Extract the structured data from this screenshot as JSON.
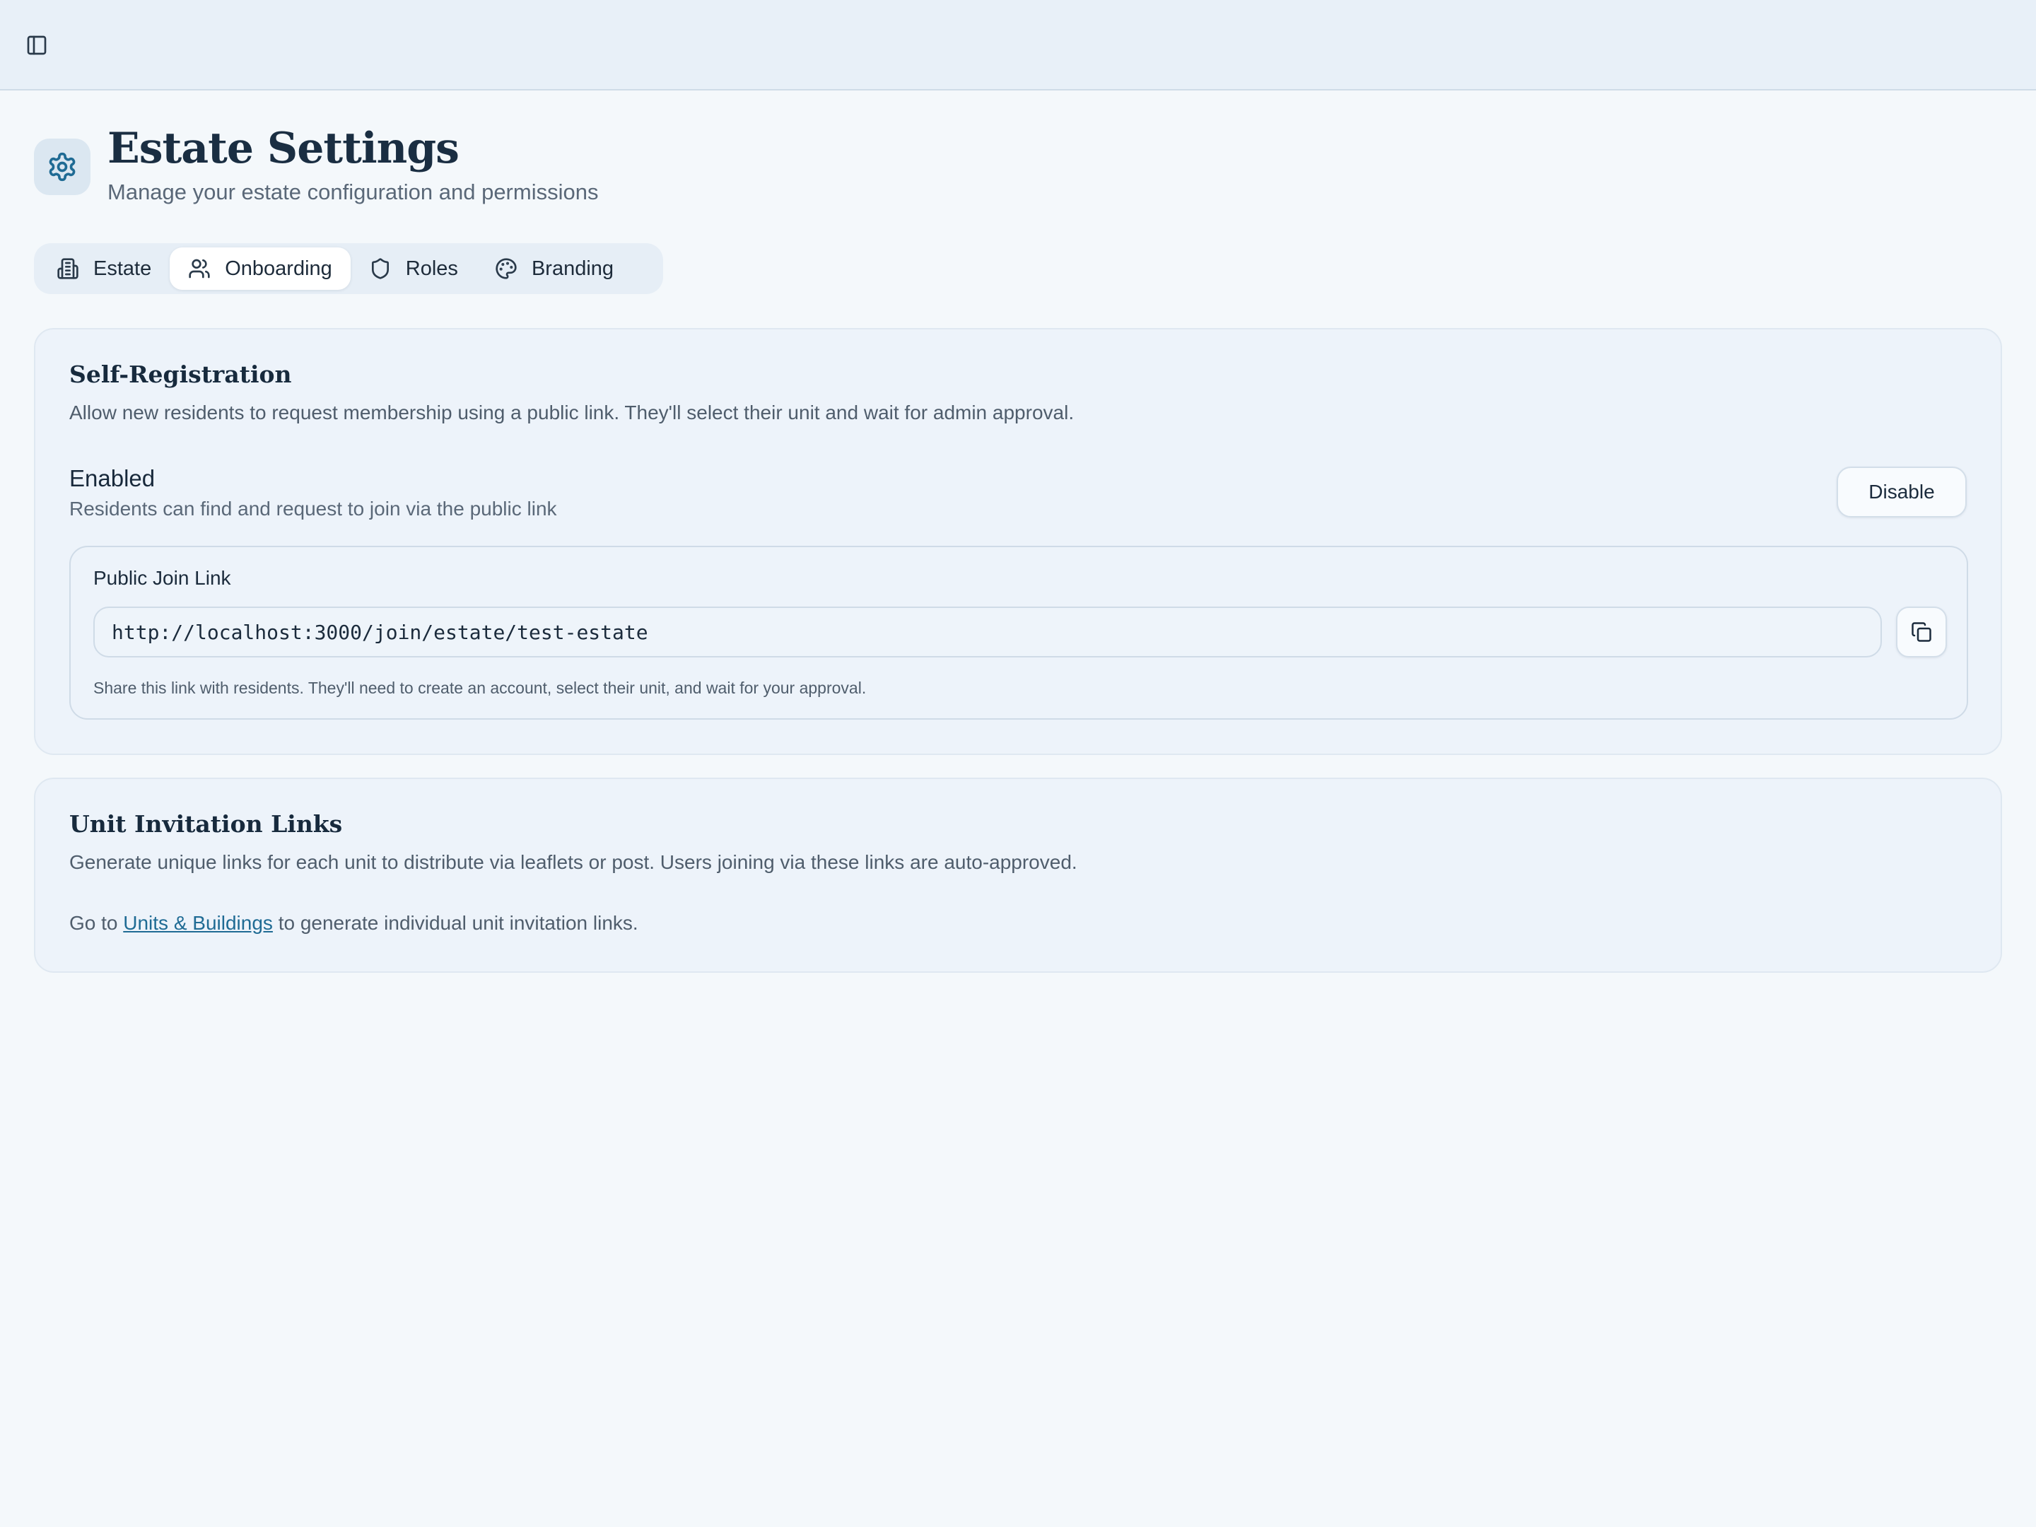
{
  "topbar": {
    "toggle_icon": "sidebar-toggle-icon"
  },
  "header": {
    "icon": "gear-icon",
    "title": "Estate Settings",
    "subtitle": "Manage your estate configuration and permissions"
  },
  "tabs": [
    {
      "label": "Estate",
      "icon": "building-icon",
      "active": false
    },
    {
      "label": "Onboarding",
      "icon": "users-icon",
      "active": true
    },
    {
      "label": "Roles",
      "icon": "shield-icon",
      "active": false
    },
    {
      "label": "Branding",
      "icon": "palette-icon",
      "active": false
    }
  ],
  "self_registration": {
    "title": "Self-Registration",
    "description": "Allow new residents to request membership using a public link. They'll select their unit and wait for admin approval.",
    "status_label": "Enabled",
    "status_description": "Residents can find and request to join via the public link",
    "disable_label": "Disable",
    "public_link": {
      "label": "Public Join Link",
      "value": "http://localhost:3000/join/estate/test-estate",
      "copy_icon": "copy-icon",
      "help": "Share this link with residents. They'll need to create an account, select their unit, and wait for your approval."
    }
  },
  "unit_invitations": {
    "title": "Unit Invitation Links",
    "description": "Generate unique links for each unit to distribute via leaflets or post. Users joining via these links are auto-approved.",
    "goto_prefix": "Go to ",
    "goto_link": "Units & Buildings",
    "goto_suffix": " to generate individual unit invitation links."
  },
  "colors": {
    "accent": "#1f6b94",
    "background": "#f4f8fb",
    "card": "#edf3fa"
  }
}
